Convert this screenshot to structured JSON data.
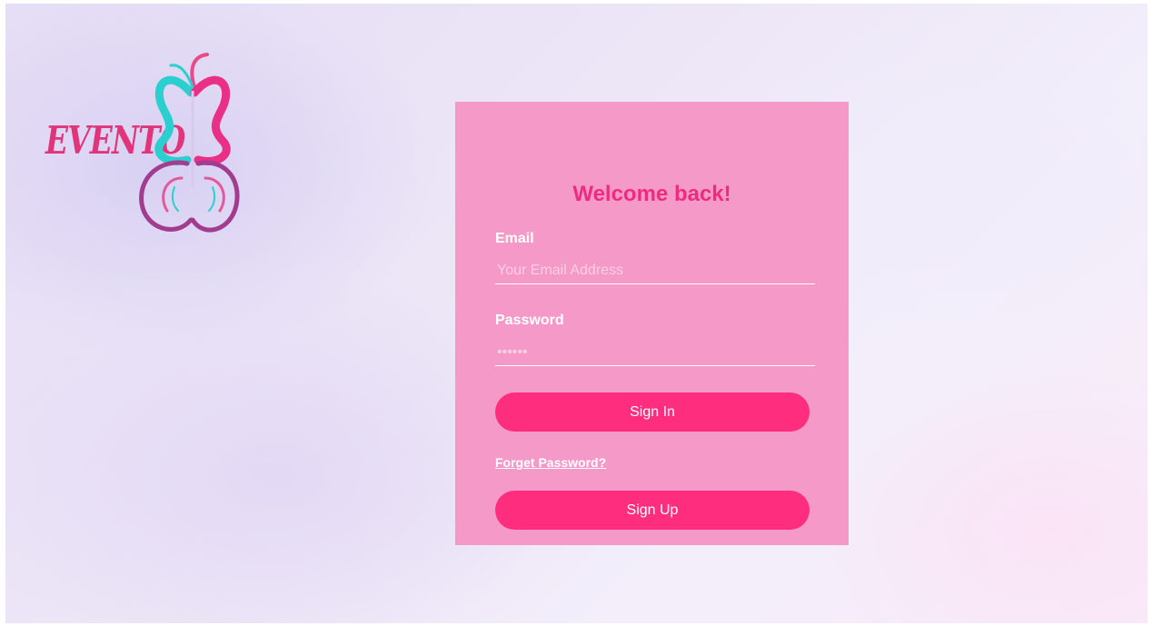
{
  "brand": {
    "logo_text": "EVENTO",
    "logo_icon": "butterfly-icon"
  },
  "login": {
    "title": "Welcome back!",
    "email_label": "Email",
    "email_placeholder": "Your Email Address",
    "email_value": "",
    "password_label": "Password",
    "password_placeholder": "••••••",
    "password_value": "",
    "sign_in_label": "Sign In",
    "forget_label": "Forget Password?",
    "sign_up_label": "Sign Up"
  },
  "colors": {
    "card": "#f59ac8",
    "accent": "#ff2d7d",
    "title": "#ee2b80",
    "logo_pink": "#e0357a",
    "logo_teal": "#2ccfcf",
    "logo_purple": "#a23c8f"
  }
}
